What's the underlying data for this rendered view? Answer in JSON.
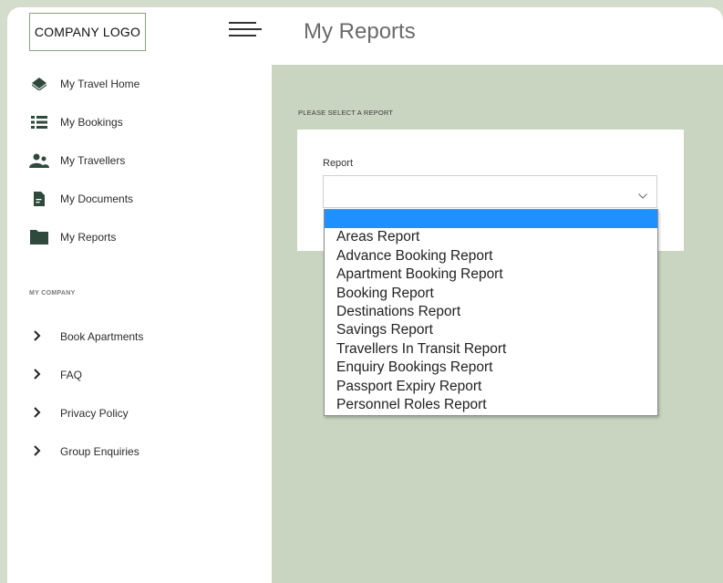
{
  "sidebar": {
    "logo": "COMPANY LOGO",
    "nav": [
      {
        "label": "My Travel Home",
        "icon": "diamond-icon"
      },
      {
        "label": "My Bookings",
        "icon": "list-icon"
      },
      {
        "label": "My Travellers",
        "icon": "people-icon"
      },
      {
        "label": "My Documents",
        "icon": "document-icon"
      },
      {
        "label": "My Reports",
        "icon": "folder-icon"
      }
    ],
    "section_label": "MY COMPANY",
    "links": [
      {
        "label": "Book Apartments",
        "icon": "chevron-right-icon"
      },
      {
        "label": "FAQ",
        "icon": "chevron-right-icon"
      },
      {
        "label": "Privacy Policy",
        "icon": "chevron-right-icon"
      },
      {
        "label": "Group Enquiries",
        "icon": "chevron-right-icon"
      }
    ]
  },
  "header": {
    "title": "My Reports"
  },
  "main": {
    "prompt": "PLEASE SELECT A REPORT",
    "field_label": "Report",
    "selected_value": "",
    "options": [
      "",
      "Areas Report",
      "Advance Booking Report",
      "Apartment Booking Report",
      "Booking Report",
      "Destinations Report",
      "Savings Report",
      "Travellers In Transit Report",
      "Enquiry Bookings Report",
      "Passport Expiry Report",
      "Personnel Roles Report"
    ]
  },
  "colors": {
    "accent_green": "#2f4a3c",
    "background": "#c9d5c1",
    "highlight": "#1e90ff"
  }
}
